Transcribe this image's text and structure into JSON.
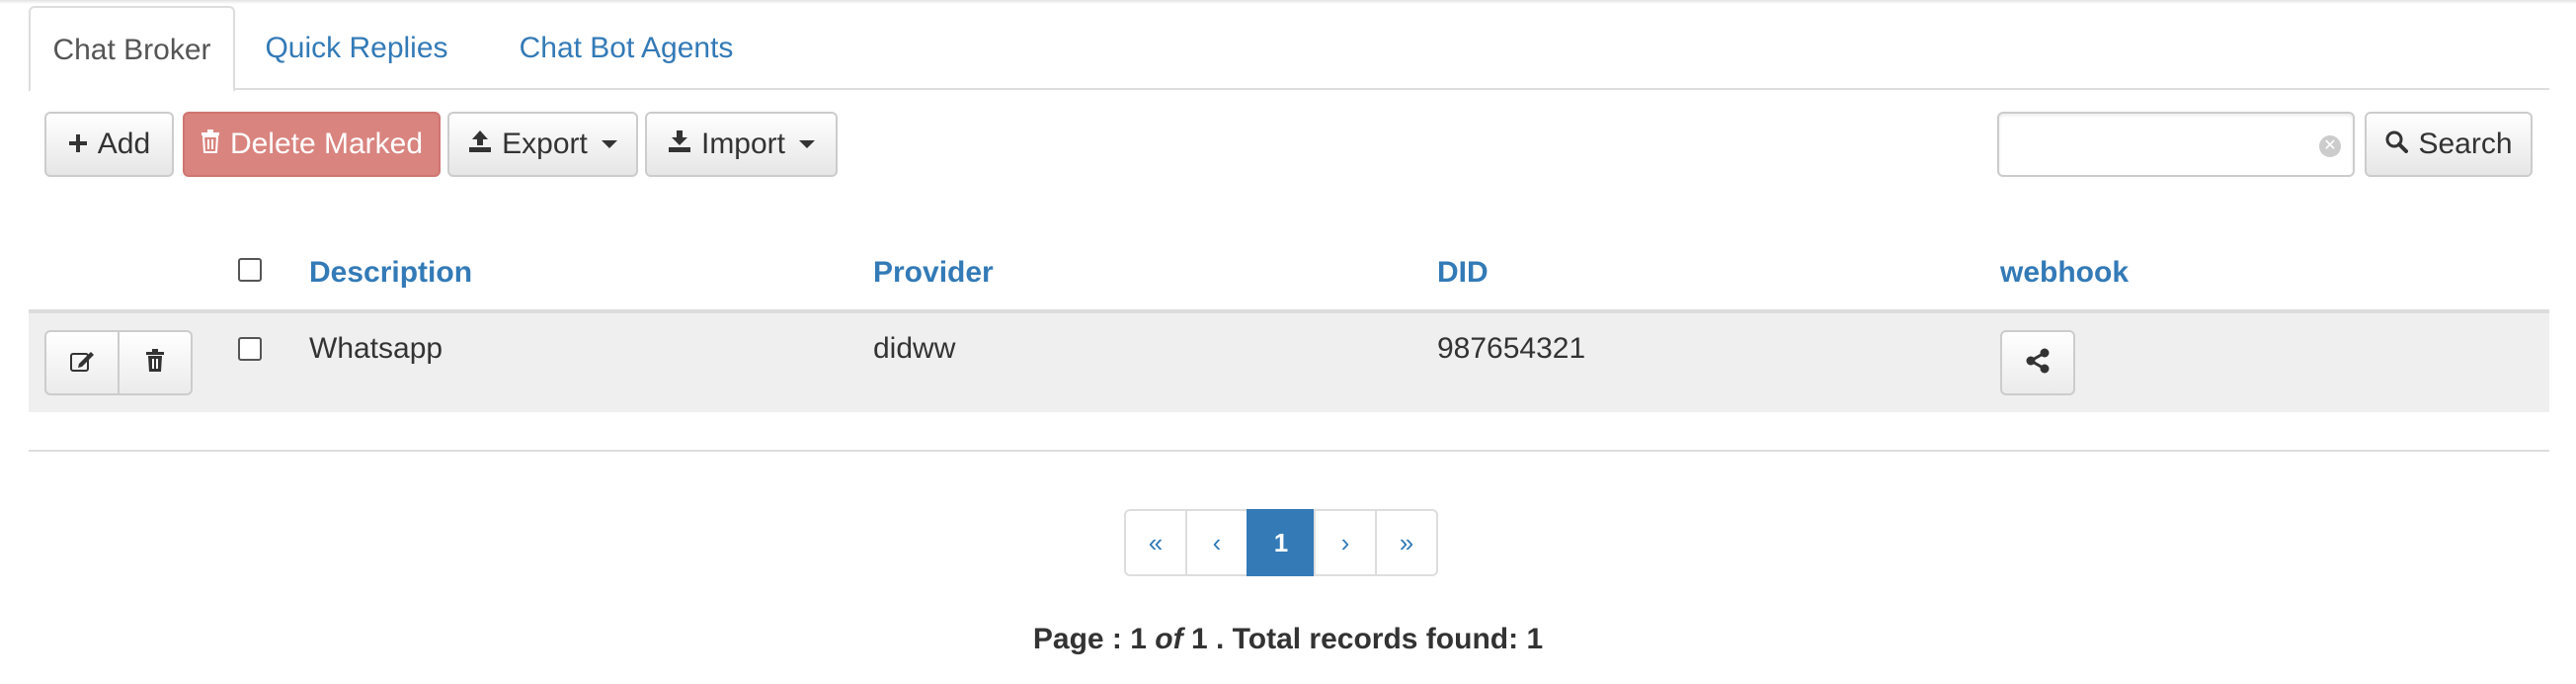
{
  "tabs": [
    {
      "label": "Chat Broker",
      "active": true
    },
    {
      "label": "Quick Replies",
      "active": false
    },
    {
      "label": "Chat Bot Agents",
      "active": false
    }
  ],
  "toolbar": {
    "add_label": "Add",
    "delete_label": "Delete Marked",
    "export_label": "Export",
    "import_label": "Import",
    "search_value": "",
    "search_label": "Search"
  },
  "table": {
    "columns": [
      "Description",
      "Provider",
      "DID",
      "webhook"
    ],
    "rows": [
      {
        "description": "Whatsapp",
        "provider": "didww",
        "did": "987654321"
      }
    ]
  },
  "pagination": {
    "first": "«",
    "prev": "‹",
    "current": "1",
    "next": "›",
    "last": "»"
  },
  "footer": {
    "page_prefix": "Page : ",
    "page": "1",
    "of_word": "of",
    "total_pages": "1",
    "records_text": ". Total records found: ",
    "total_records": "1"
  },
  "colors": {
    "link": "#337ab7",
    "danger": "#d9847f",
    "row_bg": "#efefef"
  }
}
